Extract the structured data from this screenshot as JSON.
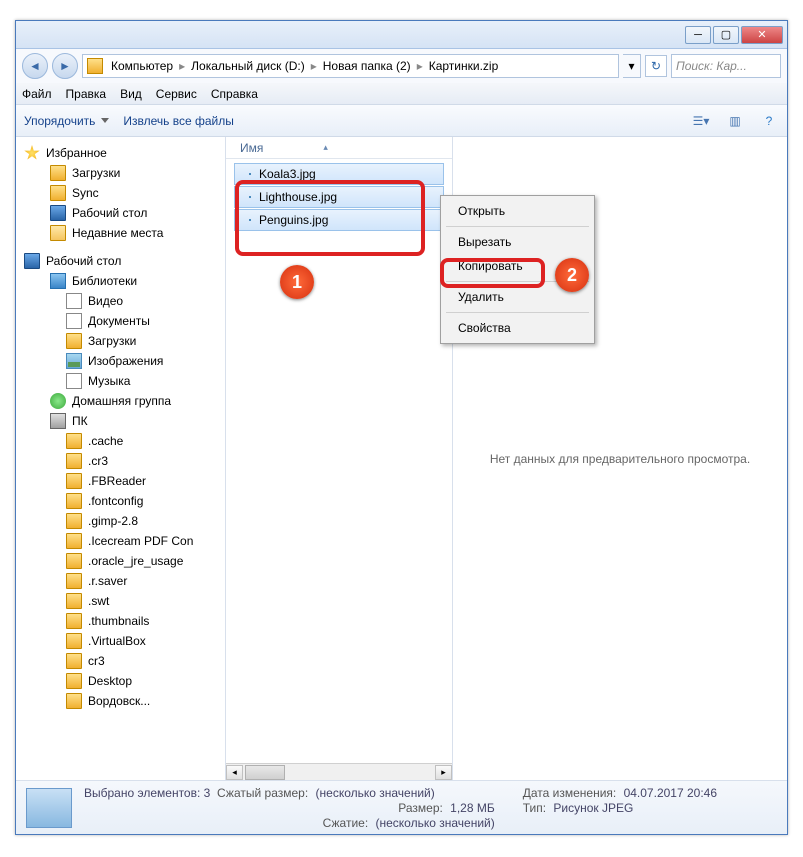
{
  "breadcrumb": [
    "Компьютер",
    "Локальный диск (D:)",
    "Новая папка (2)",
    "Картинки.zip"
  ],
  "search_placeholder": "Поиск: Кар...",
  "menubar": {
    "file": "Файл",
    "edit": "Правка",
    "view": "Вид",
    "tools": "Сервис",
    "help": "Справка"
  },
  "toolbar": {
    "organize": "Упорядочить",
    "extract": "Извлечь все файлы"
  },
  "sidebar": {
    "favorites": "Избранное",
    "fav_items": [
      "Загрузки",
      "Sync",
      "Рабочий стол",
      "Недавние места"
    ],
    "desktop": "Рабочий стол",
    "libraries": "Библиотеки",
    "lib_items": [
      "Видео",
      "Документы",
      "Загрузки",
      "Изображения",
      "Музыка"
    ],
    "homegroup": "Домашняя группа",
    "pc": "ПК",
    "pc_items": [
      ".cache",
      ".cr3",
      ".FBReader",
      ".fontconfig",
      ".gimp-2.8",
      ".Icecream PDF Con",
      ".oracle_jre_usage",
      ".r.saver",
      ".swt",
      ".thumbnails",
      ".VirtualBox",
      "cr3",
      "Desktop",
      "Вордовск..."
    ]
  },
  "files": {
    "column": "Имя",
    "rows": [
      "Koala3.jpg",
      "Lighthouse.jpg",
      "Penguins.jpg"
    ]
  },
  "preview_text": "Нет данных для предварительного просмотра.",
  "context": {
    "open": "Открыть",
    "cut": "Вырезать",
    "copy": "Копировать",
    "delete": "Удалить",
    "properties": "Свойства"
  },
  "status": {
    "selected_k": "Выбрано элементов: 3",
    "zipsize_k": "Сжатый размер:",
    "zipsize_v": "(несколько значений)",
    "size_k": "Размер:",
    "size_v": "1,28 МБ",
    "compress_k": "Сжатие:",
    "compress_v": "(несколько значений)",
    "date_k": "Дата изменения:",
    "date_v": "04.07.2017 20:46",
    "type_k": "Тип:",
    "type_v": "Рисунок JPEG"
  },
  "markers": {
    "m1": "1",
    "m2": "2"
  }
}
